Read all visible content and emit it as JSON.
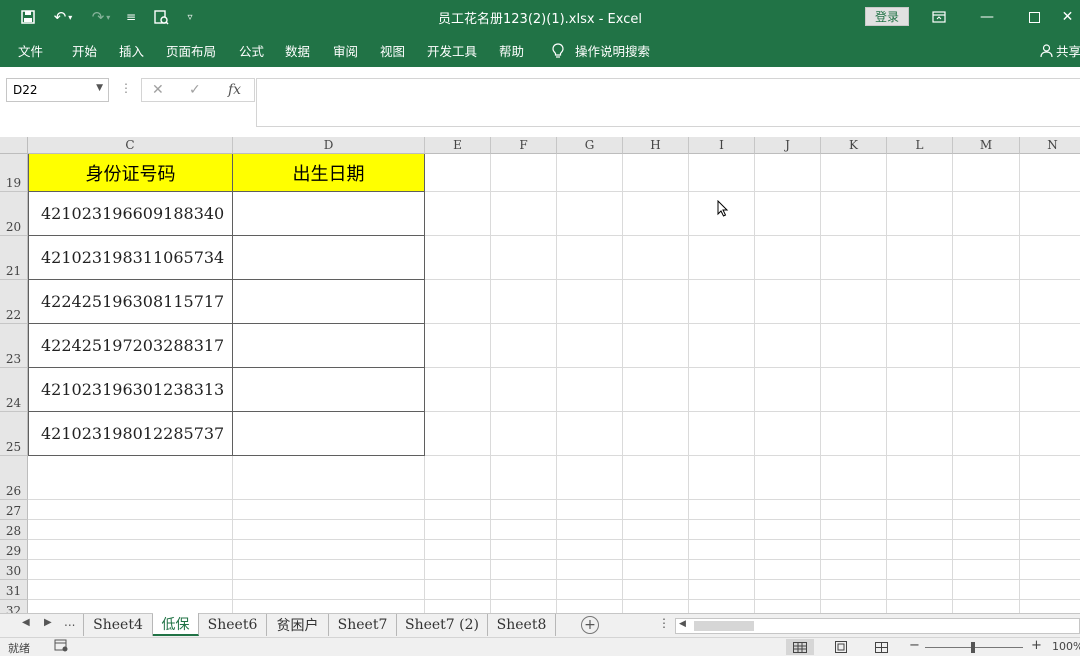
{
  "window": {
    "title": "员工花名册123(2)(1).xlsx  -  Excel",
    "login": "登录",
    "share": "共享"
  },
  "quick_access": [
    "save-icon",
    "undo-icon",
    "redo-icon",
    "print-preview-icon",
    "customize-icon"
  ],
  "ribbon_tabs": [
    "文件",
    "开始",
    "插入",
    "页面布局",
    "公式",
    "数据",
    "审阅",
    "视图",
    "开发工具",
    "帮助",
    "操作说明搜索"
  ],
  "formula_bar": {
    "name_box": "D22",
    "cancel": "✕",
    "enter": "✓",
    "fx": "fx",
    "formula": ""
  },
  "columns": [
    "C",
    "D",
    "E",
    "F",
    "G",
    "H",
    "I",
    "J",
    "K",
    "L",
    "M",
    "N"
  ],
  "rows": [
    "19",
    "20",
    "21",
    "22",
    "23",
    "24",
    "25",
    "26",
    "27",
    "28",
    "29",
    "30",
    "31",
    "32"
  ],
  "table": {
    "headers": [
      "身份证号码",
      "出生日期"
    ],
    "id_numbers": [
      "421023196609188340",
      "421023198311065734",
      "422425196308115717",
      "422425197203288317",
      "421023196301238313",
      "421023198012285737"
    ],
    "birth_dates": [
      "",
      "",
      "",
      "",
      "",
      ""
    ]
  },
  "sheets": {
    "more": "...",
    "tabs": [
      "Sheet4",
      "低保",
      "Sheet6",
      "贫困户",
      "Sheet7",
      "Sheet7 (2)",
      "Sheet8"
    ],
    "active": "低保"
  },
  "status": {
    "ready": "就绪",
    "zoom": "100%"
  },
  "colors": {
    "accent": "#217346",
    "header_fill": "#ffff00"
  }
}
